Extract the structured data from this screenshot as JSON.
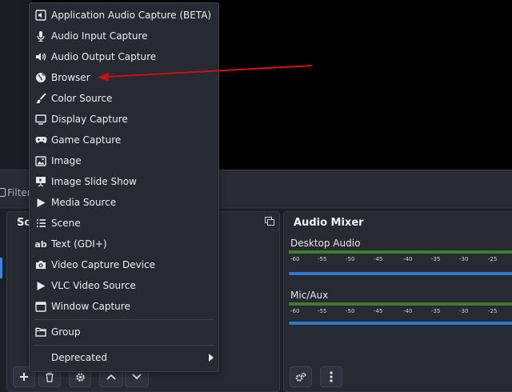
{
  "filters_label": "Filter",
  "sources_title": "So",
  "mixer": {
    "title": "Audio Mixer",
    "channels": [
      {
        "name": "Desktop Audio",
        "ticks": [
          "-60",
          "-55",
          "-50",
          "-45",
          "-40",
          "-35",
          "-30",
          "-25"
        ]
      },
      {
        "name": "Mic/Aux",
        "ticks": [
          "-60",
          "-55",
          "-50",
          "-45",
          "-40",
          "-35",
          "-30",
          "-25"
        ]
      }
    ]
  },
  "menu": {
    "items": [
      {
        "label": "Application Audio Capture (BETA)",
        "icon": "app-audio-icon"
      },
      {
        "label": "Audio Input Capture",
        "icon": "microphone-icon"
      },
      {
        "label": "Audio Output Capture",
        "icon": "speaker-icon"
      },
      {
        "label": "Browser",
        "icon": "globe-icon"
      },
      {
        "label": "Color Source",
        "icon": "brush-icon"
      },
      {
        "label": "Display Capture",
        "icon": "monitor-icon"
      },
      {
        "label": "Game Capture",
        "icon": "gamepad-icon"
      },
      {
        "label": "Image",
        "icon": "image-icon"
      },
      {
        "label": "Image Slide Show",
        "icon": "slideshow-icon"
      },
      {
        "label": "Media Source",
        "icon": "play-icon"
      },
      {
        "label": "Scene",
        "icon": "list-icon"
      },
      {
        "label": "Text (GDI+)",
        "icon": "text-icon"
      },
      {
        "label": "Video Capture Device",
        "icon": "camera-icon"
      },
      {
        "label": "VLC Video Source",
        "icon": "vlc-icon"
      },
      {
        "label": "Window Capture",
        "icon": "window-icon"
      }
    ],
    "group_label": "Group",
    "deprecated_label": "Deprecated"
  },
  "colors": {
    "annotation_arrow": "#cc1010",
    "accent": "#2f7ad1",
    "meter": "#3e7d2b"
  }
}
